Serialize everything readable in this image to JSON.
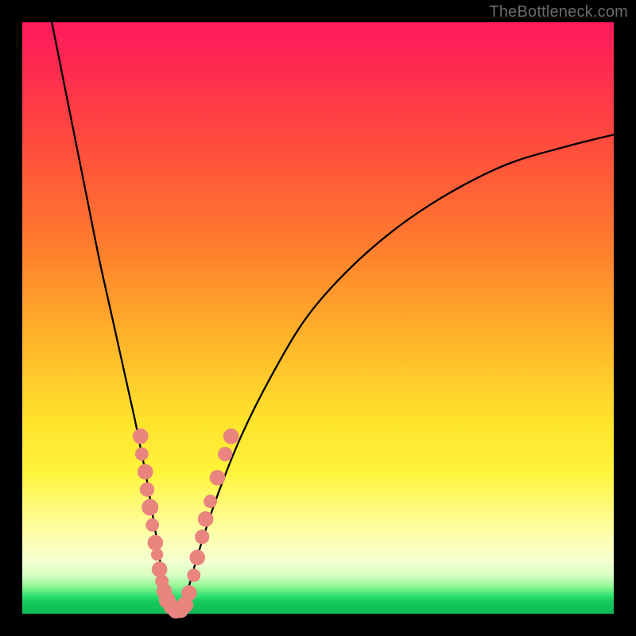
{
  "watermark": "TheBottleneck.com",
  "colors": {
    "curve": "#000000",
    "marker_fill": "#e9847e",
    "marker_stroke": "#e9847e"
  },
  "chart_data": {
    "type": "line",
    "title": "",
    "xlabel": "",
    "ylabel": "",
    "xlim": [
      0,
      100
    ],
    "ylim": [
      0,
      100
    ],
    "note": "Axes have no visible tick labels; values are normalized 0–100 estimated from pixel positions. y represents bottleneck % (0 at curve bottom / green zone, 100 at top / red zone).",
    "series": [
      {
        "name": "bottleneck-curve",
        "x": [
          5,
          7,
          9,
          11,
          13,
          15,
          17,
          19,
          20,
          21,
          22,
          23,
          23.7,
          24.3,
          25,
          26,
          27,
          28,
          30,
          33,
          37,
          42,
          48,
          55,
          63,
          72,
          82,
          92,
          100
        ],
        "y": [
          100,
          90,
          80,
          70,
          60,
          51,
          42,
          33,
          28,
          23,
          17,
          11,
          6,
          3,
          1,
          0,
          1,
          4,
          11,
          20,
          30,
          40,
          50,
          58,
          65,
          71,
          76,
          79,
          81
        ]
      }
    ],
    "markers": {
      "name": "highlighted-points",
      "comment": "Salmon dots clustered near the curve bottom on both branches, roughly in the 0–30% bottleneck band.",
      "points": [
        {
          "x": 20.0,
          "y": 30.0,
          "r": 1.4
        },
        {
          "x": 20.2,
          "y": 27.0,
          "r": 1.2
        },
        {
          "x": 20.8,
          "y": 24.0,
          "r": 1.4
        },
        {
          "x": 21.1,
          "y": 21.0,
          "r": 1.3
        },
        {
          "x": 21.6,
          "y": 18.0,
          "r": 1.5
        },
        {
          "x": 22.0,
          "y": 15.0,
          "r": 1.2
        },
        {
          "x": 22.5,
          "y": 12.0,
          "r": 1.4
        },
        {
          "x": 22.8,
          "y": 10.0,
          "r": 1.1
        },
        {
          "x": 23.2,
          "y": 7.5,
          "r": 1.4
        },
        {
          "x": 23.6,
          "y": 5.5,
          "r": 1.2
        },
        {
          "x": 24.0,
          "y": 3.8,
          "r": 1.4
        },
        {
          "x": 24.5,
          "y": 2.3,
          "r": 1.5
        },
        {
          "x": 25.2,
          "y": 1.2,
          "r": 1.4
        },
        {
          "x": 26.0,
          "y": 0.6,
          "r": 1.5
        },
        {
          "x": 26.8,
          "y": 0.6,
          "r": 1.4
        },
        {
          "x": 27.5,
          "y": 1.5,
          "r": 1.5
        },
        {
          "x": 28.2,
          "y": 3.5,
          "r": 1.4
        },
        {
          "x": 29.0,
          "y": 6.5,
          "r": 1.2
        },
        {
          "x": 29.6,
          "y": 9.5,
          "r": 1.4
        },
        {
          "x": 30.4,
          "y": 13.0,
          "r": 1.3
        },
        {
          "x": 31.0,
          "y": 16.0,
          "r": 1.4
        },
        {
          "x": 31.8,
          "y": 19.0,
          "r": 1.2
        },
        {
          "x": 33.0,
          "y": 23.0,
          "r": 1.4
        },
        {
          "x": 34.3,
          "y": 27.0,
          "r": 1.3
        },
        {
          "x": 35.3,
          "y": 30.0,
          "r": 1.4
        }
      ]
    }
  }
}
